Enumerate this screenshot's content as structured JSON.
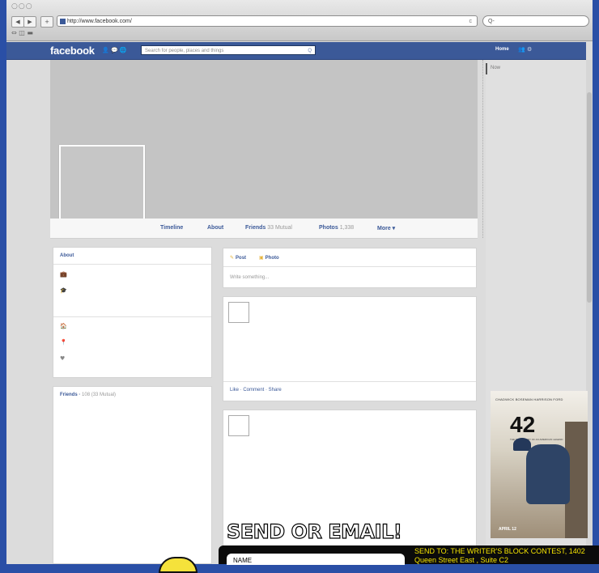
{
  "browser": {
    "url": "http://www.facebook.com/",
    "search_placeholder": "Q-",
    "back_glyph": "◀",
    "forward_glyph": "▶",
    "add_glyph": "+",
    "reload_glyph": "c",
    "bookmarks_glyphs": "⇔ ◫ ▬",
    "window_dots": "○○○"
  },
  "facebook": {
    "logo": "facebook",
    "search_placeholder": "Search for people, places and things",
    "search_glyph": "Q",
    "home_label": "Home",
    "header_icons": "👤 💬 🌐",
    "right_icons": "👥 ⚙",
    "tabs": [
      {
        "label": "Timeline",
        "count": ""
      },
      {
        "label": "About",
        "count": ""
      },
      {
        "label": "Friends",
        "count": "33 Mutual"
      },
      {
        "label": "Photos",
        "count": "1,338"
      },
      {
        "label": "More ▾",
        "count": ""
      }
    ],
    "about": {
      "heading": "About",
      "icons": [
        "work-icon",
        "education-icon",
        "home-icon",
        "location-icon",
        "relationship-icon"
      ],
      "glyphs": [
        "💼",
        "🎓",
        "🏠",
        "📍",
        "♥"
      ]
    },
    "friends": {
      "heading": "Friends",
      "count": "108 (33 Mutual)"
    },
    "composer": {
      "post_label": "Post",
      "photo_label": "Photo",
      "write_placeholder": "Write something..."
    },
    "story_actions": "Like · Comment · Share",
    "ticker_label": "Now"
  },
  "ad": {
    "names": "CHADWICK BOSEMAN   HARRISON FORD",
    "title": "42",
    "tagline": "THE TRUE STORY OF AN AMERICAN LEGEND",
    "date": "APRIL 12"
  },
  "contest": {
    "title": "SEND OR EMAIL!",
    "name_label": "NAME",
    "send_to": "SEND TO: THE WRITER'S BLOCK CONTEST, 1402 Queen Street East , Suite C2"
  },
  "colors": {
    "fb_blue": "#3b5998",
    "background_blue": "#2a4fa6",
    "contest_yellow": "#f7e600"
  }
}
